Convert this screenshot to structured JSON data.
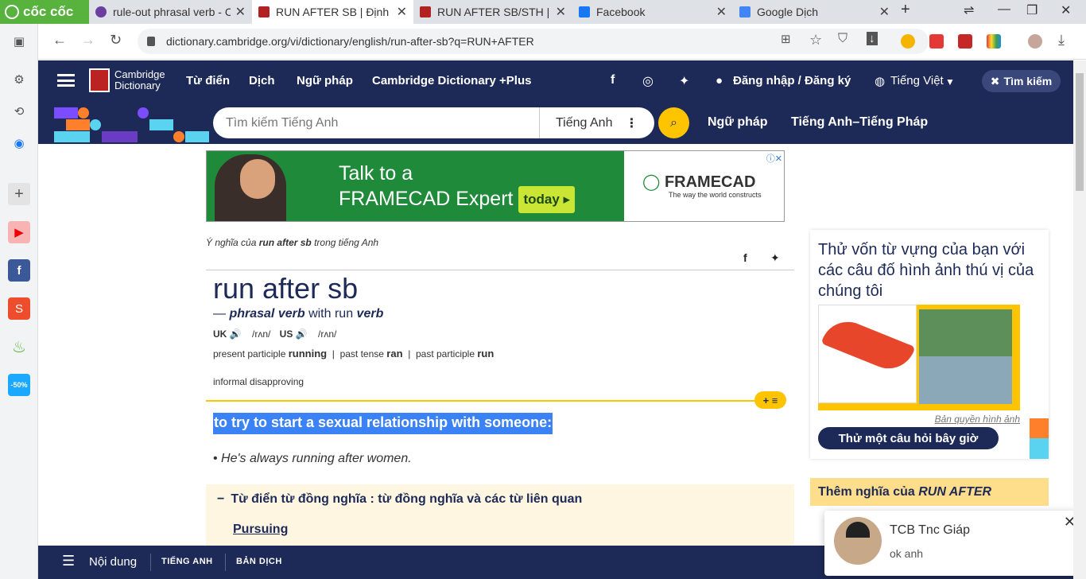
{
  "browser": {
    "brand": "cốc cốc",
    "tabs": [
      {
        "title": "rule-out phrasal verb - C",
        "color": "#6b3fa0",
        "active": false
      },
      {
        "title": "RUN AFTER SB | Định ng",
        "color": "#b22222",
        "active": true
      },
      {
        "title": "RUN AFTER SB/STH | Đị",
        "color": "#b22222",
        "active": false
      },
      {
        "title": "Facebook",
        "color": "#1877f2",
        "active": false
      },
      {
        "title": "Google Dịch",
        "color": "#4285f4",
        "active": false
      }
    ],
    "url": "dictionary.cambridge.org/vi/dictionary/english/run-after-sb?q=RUN+AFTER"
  },
  "header": {
    "logo_line1": "Cambridge",
    "logo_line2": "Dictionary",
    "nav": [
      "Từ điển",
      "Dịch",
      "Ngữ pháp",
      "Cambridge Dictionary +Plus"
    ],
    "login": "Đăng nhập / Đăng ký",
    "language": "Tiếng Việt",
    "search_button": "Tìm kiếm"
  },
  "search": {
    "placeholder": "Tìm kiếm Tiếng Anh",
    "language": "Tiếng Anh",
    "links": [
      "Ngữ pháp",
      "Tiếng Anh–Tiếng Pháp"
    ]
  },
  "ad": {
    "line1": "Talk to a",
    "line2": "FRAMECAD Expert",
    "cta": "today ▸",
    "brand": "FRAMECAD",
    "tagline": "The way the world constructs"
  },
  "entry": {
    "meaning_prefix": "Ý nghĩa của",
    "meaning_word": "run after sb",
    "meaning_suffix": "trong tiếng Anh",
    "headword": "run after sb",
    "pos_dash": "—",
    "pos": "phrasal verb",
    "pos_with": "with run",
    "pos_verb": "verb",
    "uk_label": "UK",
    "uk_ipa": "/rʌn/",
    "us_label": "US",
    "us_ipa": "/rʌn/",
    "forms": [
      {
        "label": "present participle",
        "value": "running"
      },
      {
        "label": "past tense",
        "value": "ran"
      },
      {
        "label": "past participle",
        "value": "run"
      }
    ],
    "labels": "informal disapproving",
    "pill": "+ ≡",
    "definition": "to try to start a sexual relationship with someone:",
    "example": "He's always running after women.",
    "thesaurus_title": "Từ điển từ đồng nghĩa : từ đồng nghĩa và các từ liên quan",
    "thesaurus_link": "Pursuing"
  },
  "quiz": {
    "question": "Thử vốn từ vựng của bạn với các câu đố hình ảnh thú vị của chúng tôi",
    "credit": "Bản quyền hình ảnh",
    "button": "Thử một câu hỏi bây giờ"
  },
  "more": {
    "prefix": "Thêm nghĩa của",
    "word": "RUN AFTER"
  },
  "bottombar": {
    "contents": "Nội dung",
    "english": "TIẾNG ANH",
    "translation": "BẢN DỊCH"
  },
  "chat": {
    "name": "TCB Tnc Giáp",
    "message": "ok anh"
  },
  "colors": {
    "navy": "#1d2a57",
    "yellow": "#fec400",
    "highlight": "#3b82f6",
    "coccoc_green": "#57b33e"
  }
}
